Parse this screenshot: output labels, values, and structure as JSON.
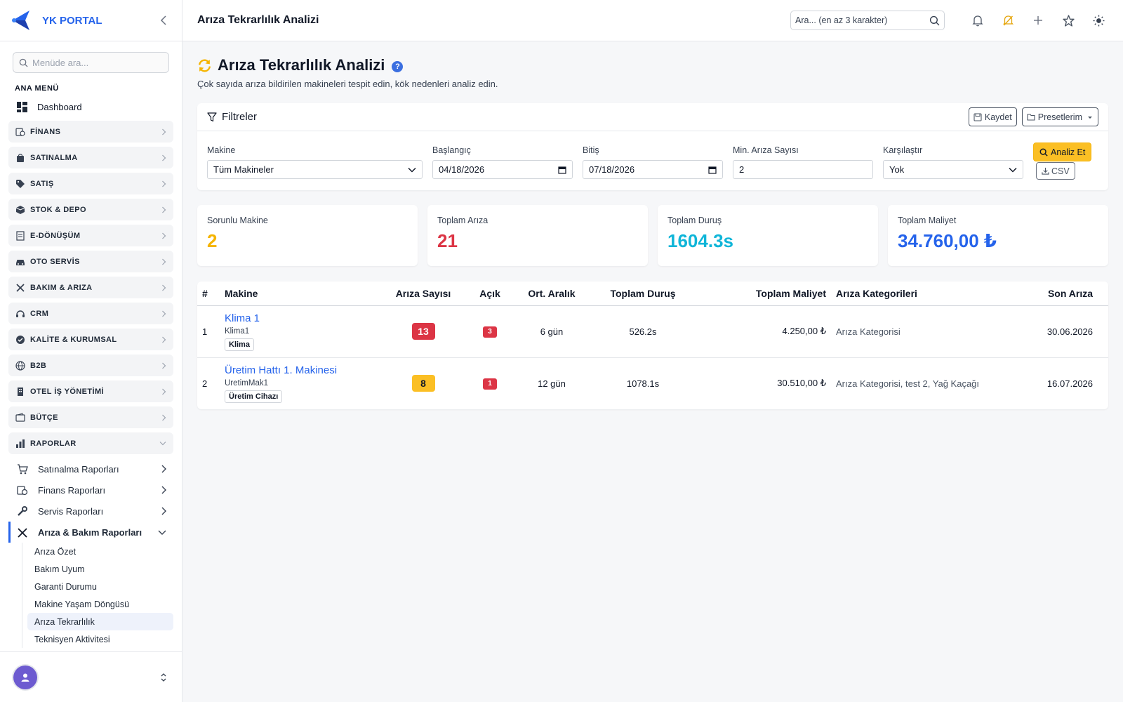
{
  "brand": {
    "name": "YK PORTAL"
  },
  "sidebar": {
    "search_placeholder": "Menüde ara...",
    "section_label": "ANA MENÜ",
    "dashboard": "Dashboard",
    "groups": [
      {
        "label": "FİNANS",
        "icon": "finance-icon"
      },
      {
        "label": "SATINALMA",
        "icon": "shopping-bag-icon"
      },
      {
        "label": "SATIŞ",
        "icon": "tag-icon"
      },
      {
        "label": "STOK & DEPO",
        "icon": "box-icon"
      },
      {
        "label": "E-DÖNÜŞÜM",
        "icon": "document-icon"
      },
      {
        "label": "OTO SERVİS",
        "icon": "car-icon"
      },
      {
        "label": "BAKIM & ARIZA",
        "icon": "tools-icon"
      },
      {
        "label": "CRM",
        "icon": "headset-icon"
      },
      {
        "label": "KALİTE & KURUMSAL",
        "icon": "badge-icon"
      },
      {
        "label": "B2B",
        "icon": "globe-icon"
      },
      {
        "label": "OTEL İŞ YÖNETİMİ",
        "icon": "building-icon"
      },
      {
        "label": "BÜTÇE",
        "icon": "wallet-icon"
      },
      {
        "label": "RAPORLAR",
        "icon": "bar-chart-icon"
      }
    ],
    "report_items": [
      "Satınalma Raporları",
      "Finans Raporları",
      "Servis Raporları",
      "Arıza & Bakım Raporları"
    ],
    "leaves": [
      "Arıza Özet",
      "Bakım Uyum",
      "Garanti Durumu",
      "Makine Yaşam Döngüsü",
      "Arıza Tekrarlılık",
      "Teknisyen Aktivitesi"
    ]
  },
  "topbar": {
    "title": "Arıza Tekrarlılık Analizi",
    "search_placeholder": "Ara... (en az 3 karakter)"
  },
  "page": {
    "title": "Arıza Tekrarlılık Analizi",
    "help": "?",
    "subtitle": "Çok sayıda arıza bildirilen makineleri tespit edin, kök nedenleri analiz edin."
  },
  "filters": {
    "title": "Filtreler",
    "save_label": "Kaydet",
    "presets_label": "Presetlerim",
    "machine_label": "Makine",
    "machine_value": "Tüm Makineler",
    "start_label": "Başlangıç",
    "start_value": "04/18/2026",
    "end_label": "Bitiş",
    "end_value": "07/18/2026",
    "min_label": "Min. Arıza Sayısı",
    "min_value": "2",
    "compare_label": "Karşılaştır",
    "compare_value": "Yok",
    "analyze_label": "Analiz Et",
    "csv_label": "CSV"
  },
  "stats": [
    {
      "label": "Sorunlu Makine",
      "value": "2",
      "color": "#f5b400"
    },
    {
      "label": "Toplam Arıza",
      "value": "21",
      "color": "#dc3545"
    },
    {
      "label": "Toplam Duruş",
      "value": "1604.3s",
      "color": "#0fb5d8"
    },
    {
      "label": "Toplam Maliyet",
      "value": "34.760,00 ₺",
      "color": "#2563eb"
    }
  ],
  "table": {
    "headers": [
      "#",
      "Makine",
      "Arıza Sayısı",
      "Açık",
      "Ort. Aralık",
      "Toplam Duruş",
      "Toplam Maliyet",
      "Arıza Kategorileri",
      "Son Arıza"
    ],
    "rows": [
      {
        "no": "1",
        "name": "Klima 1",
        "code": "Klima1",
        "type": "Klima",
        "count": "13",
        "count_color": "#dc3545",
        "open": "3",
        "interval": "6 gün",
        "downtime": "526.2s",
        "cost": "4.250,00 ₺",
        "categories": "Arıza Kategorisi",
        "last": "30.06.2026"
      },
      {
        "no": "2",
        "name": "Üretim Hattı 1. Makinesi",
        "code": "UretimMak1",
        "type": "Üretim Cihazı",
        "count": "8",
        "count_color": "#fbbf24",
        "open": "1",
        "interval": "12 gün",
        "downtime": "1078.1s",
        "cost": "30.510,00 ₺",
        "categories": "Arıza Kategorisi, test 2, Yağ Kaçağı",
        "last": "16.07.2026"
      }
    ]
  }
}
